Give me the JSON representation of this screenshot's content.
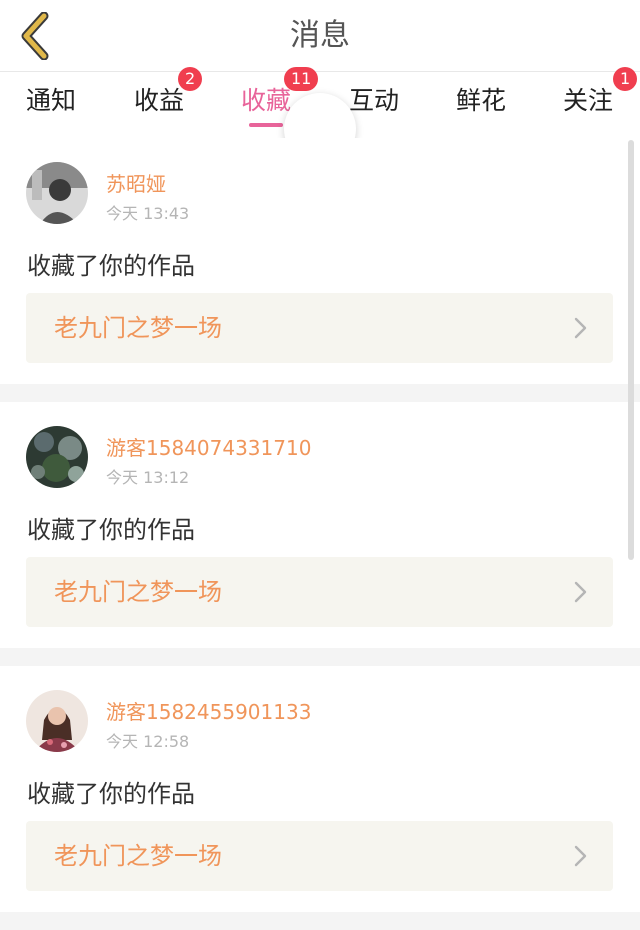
{
  "header": {
    "title": "消息"
  },
  "tabs": [
    {
      "label": "通知",
      "badge": ""
    },
    {
      "label": "收益",
      "badge": "2"
    },
    {
      "label": "收藏",
      "badge": "11",
      "active": true
    },
    {
      "label": "互动",
      "badge": ""
    },
    {
      "label": "鲜花",
      "badge": ""
    },
    {
      "label": "关注",
      "badge": "1"
    }
  ],
  "colors": {
    "accent": "#e8649a",
    "badge": "#f03e4f",
    "username": "#f0955a",
    "back_icon": "#e0b84a"
  },
  "feed": [
    {
      "username": "苏昭娅",
      "time": "今天 13:43",
      "action": "收藏了你的作品",
      "work": "老九门之梦一场"
    },
    {
      "username": "游客1584074331710",
      "time": "今天 13:12",
      "action": "收藏了你的作品",
      "work": "老九门之梦一场"
    },
    {
      "username": "游客1582455901133",
      "time": "今天 12:58",
      "action": "收藏了你的作品",
      "work": "老九门之梦一场"
    }
  ]
}
